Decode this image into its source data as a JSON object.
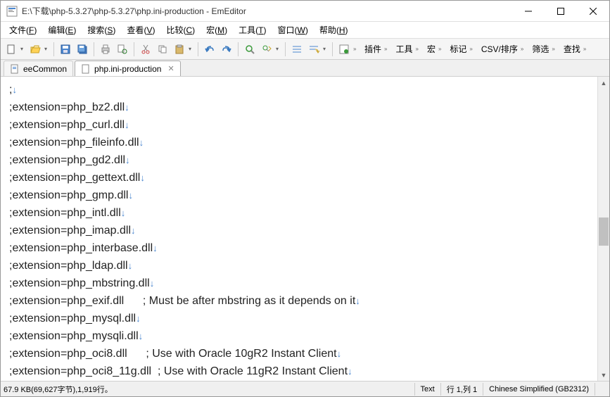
{
  "titlebar": {
    "title": "E:\\下载\\php-5.3.27\\php-5.3.27\\php.ini-production - EmEditor"
  },
  "menu": {
    "file": "文件",
    "file_u": "F",
    "edit": "编辑",
    "edit_u": "E",
    "search": "搜索",
    "search_u": "S",
    "view": "查看",
    "view_u": "V",
    "compare": "比较",
    "compare_u": "C",
    "macro": "宏",
    "macro_u": "M",
    "tools": "工具",
    "tools_u": "T",
    "window": "窗口",
    "window_u": "W",
    "help": "帮助",
    "help_u": "H"
  },
  "plugins": {
    "plugin": "插件",
    "tool": "工具",
    "macro": "宏",
    "mark": "标记",
    "csv": "CSV/排序",
    "filter": "筛选",
    "find": "查找"
  },
  "tabs": {
    "t0": "eeCommon",
    "t1": "php.ini-production"
  },
  "editor_lines": [
    ";",
    ";extension=php_bz2.dll",
    ";extension=php_curl.dll",
    ";extension=php_fileinfo.dll",
    ";extension=php_gd2.dll",
    ";extension=php_gettext.dll",
    ";extension=php_gmp.dll",
    ";extension=php_intl.dll",
    ";extension=php_imap.dll",
    ";extension=php_interbase.dll",
    ";extension=php_ldap.dll",
    ";extension=php_mbstring.dll",
    ";extension=php_exif.dll      ; Must be after mbstring as it depends on it",
    ";extension=php_mysql.dll",
    ";extension=php_mysqli.dll",
    ";extension=php_oci8.dll      ; Use with Oracle 10gR2 Instant Client",
    ";extension=php_oci8_11g.dll  ; Use with Oracle 11gR2 Instant Client"
  ],
  "status": {
    "left": "67.9 KB(69,627字节),1,919行。",
    "mode": "Text",
    "pos": "行 1,列 1",
    "enc": "Chinese Simplified (GB2312)"
  }
}
